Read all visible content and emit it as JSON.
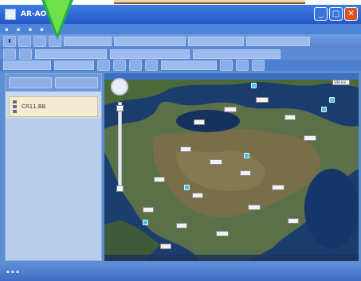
{
  "window": {
    "title": "AR-AO",
    "minimize_symbol": "_",
    "maximize_symbol": "□",
    "close_symbol": "✕"
  },
  "callout": {
    "arrow_color": "#22b04a"
  },
  "left_panel": {
    "layer_label": "CR11.BB"
  },
  "map": {
    "zoom_level": 0.88,
    "scale_label": "100 km",
    "labels": [
      "",
      "",
      "",
      "",
      "",
      "",
      "",
      "",
      "",
      "",
      "",
      "",
      "",
      "",
      "",
      "",
      "",
      ""
    ]
  },
  "colors": {
    "titlebar": "#2456c8",
    "close": "#d9542a",
    "panel": "#c9d9f0",
    "layer_box": "#f3ecd2"
  }
}
